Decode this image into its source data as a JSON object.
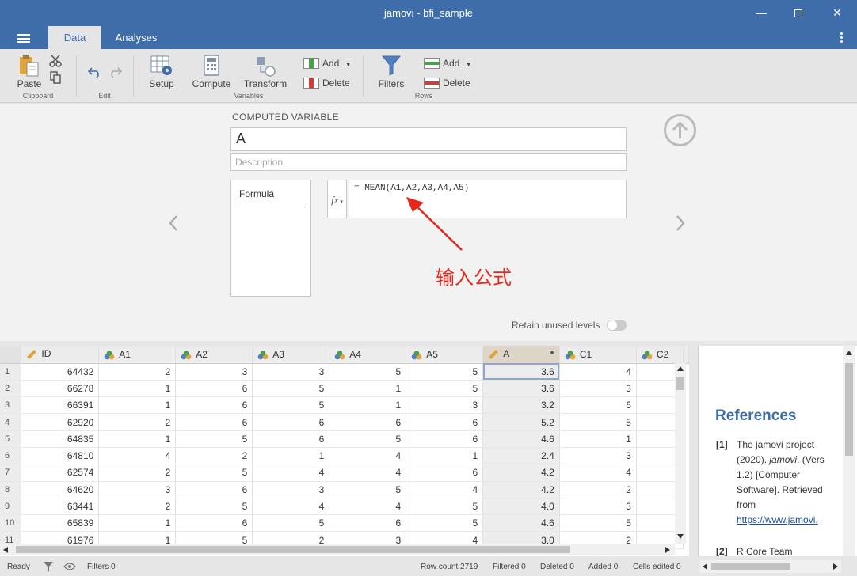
{
  "window": {
    "title": "jamovi - bfi_sample",
    "minimize": "—",
    "close": "✕"
  },
  "tabs": [
    {
      "label": "Data"
    },
    {
      "label": "Analyses"
    }
  ],
  "ribbon": {
    "paste": "Paste",
    "clipboard_group": "Clipboard",
    "edit_group": "Edit",
    "setup": "Setup",
    "compute": "Compute",
    "transform": "Transform",
    "variables_group": "Variables",
    "var_add": "Add",
    "var_delete": "Delete",
    "filters": "Filters",
    "row_add": "Add",
    "row_delete": "Delete",
    "rows_group": "Rows"
  },
  "computed": {
    "section_title": "COMPUTED VARIABLE",
    "name": "A",
    "description_placeholder": "Description",
    "formula_heading": "Formula",
    "fx": "fx",
    "formula": "= MEAN(A1,A2,A3,A4,A5)",
    "annotation": "输入公式",
    "retain_unused_levels": "Retain unused levels"
  },
  "grid": {
    "columns": [
      "ID",
      "A1",
      "A2",
      "A3",
      "A4",
      "A5",
      "A",
      "C1",
      "C2"
    ],
    "rows": [
      [
        "1",
        "64432",
        "2",
        "3",
        "3",
        "5",
        "5",
        "3.6",
        "4"
      ],
      [
        "2",
        "66278",
        "1",
        "6",
        "5",
        "1",
        "5",
        "3.6",
        "3"
      ],
      [
        "3",
        "66391",
        "1",
        "6",
        "5",
        "1",
        "3",
        "3.2",
        "6"
      ],
      [
        "4",
        "62920",
        "2",
        "6",
        "6",
        "6",
        "6",
        "5.2",
        "5"
      ],
      [
        "5",
        "64835",
        "1",
        "5",
        "6",
        "5",
        "6",
        "4.6",
        "1"
      ],
      [
        "6",
        "64810",
        "4",
        "2",
        "1",
        "4",
        "1",
        "2.4",
        "3"
      ],
      [
        "7",
        "62574",
        "2",
        "5",
        "4",
        "4",
        "6",
        "4.2",
        "4"
      ],
      [
        "8",
        "64620",
        "3",
        "6",
        "3",
        "5",
        "4",
        "4.2",
        "2"
      ],
      [
        "9",
        "63441",
        "2",
        "5",
        "4",
        "4",
        "5",
        "4.0",
        "3"
      ],
      [
        "10",
        "65839",
        "1",
        "6",
        "5",
        "6",
        "5",
        "4.6",
        "5"
      ],
      [
        "11",
        "61976",
        "1",
        "5",
        "2",
        "3",
        "4",
        "3.0",
        "2"
      ]
    ]
  },
  "results": {
    "heading": "References",
    "refs": [
      {
        "num": "[1]",
        "text_lines": [
          "The jamovi project",
          "(2020).",
          "jamovi",
          ". (Vers",
          "1.2) [Computer",
          "Software]. Retrieved",
          "from"
        ],
        "link": "https://www.jamovi."
      },
      {
        "num": "[2]",
        "text": "R Core Team"
      }
    ]
  },
  "status": {
    "ready": "Ready",
    "filters": "Filters 0",
    "row_count": "Row count 2719",
    "filtered": "Filtered 0",
    "deleted": "Deleted 0",
    "added": "Added 0",
    "cells_edited": "Cells edited 0"
  },
  "colors": {
    "accent": "#3e6da9",
    "annotation": "#e8261c"
  }
}
